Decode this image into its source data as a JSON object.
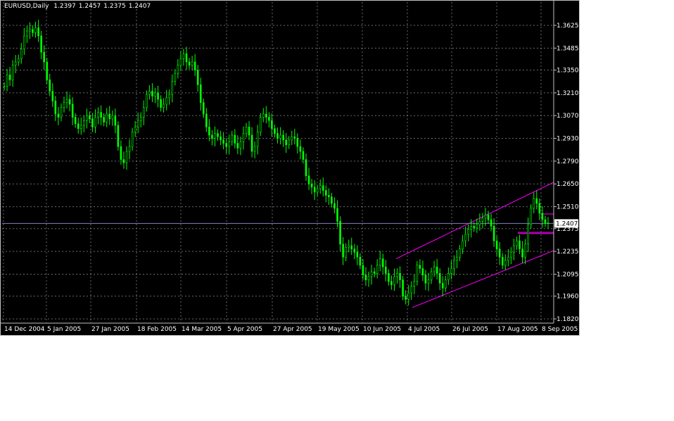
{
  "header": {
    "symbol": "EURUSD,Daily",
    "open": "1.2397",
    "high": "1.2457",
    "low": "1.2375",
    "close": "1.2407"
  },
  "colors": {
    "background": "#000000",
    "candle": "#00ff00",
    "grid": "#c0c0c0",
    "axis_text": "#ffffff",
    "channel": "#ff00ff",
    "bid_line": "#8080c0",
    "price_label_bg": "#ffffff",
    "price_label_text": "#000000"
  },
  "chart_data": {
    "type": "candlestick",
    "title": "EURUSD,Daily",
    "y_ticks": [
      "1.3625",
      "1.3485",
      "1.3350",
      "1.3210",
      "1.3070",
      "1.2930",
      "1.2790",
      "1.2650",
      "1.2510",
      "1.2375",
      "1.2235",
      "1.2095",
      "1.1960",
      "1.1820"
    ],
    "x_ticks": [
      "14 Dec 2004",
      "5 Jan 2005",
      "27 Jan 2005",
      "18 Feb 2005",
      "14 Mar 2005",
      "5 Apr 2005",
      "27 Apr 2005",
      "19 May 2005",
      "10 Jun 2005",
      "4 Jul 2005",
      "26 Jul 2005",
      "17 Aug 2005",
      "8 Sep 2005"
    ],
    "current_price": "1.2407",
    "ylim": [
      1.182,
      1.3625
    ],
    "grid": true,
    "approx_closes": [
      1.325,
      1.332,
      1.329,
      1.338,
      1.34,
      1.342,
      1.348,
      1.356,
      1.359,
      1.36,
      1.358,
      1.361,
      1.356,
      1.346,
      1.34,
      1.329,
      1.322,
      1.316,
      1.308,
      1.306,
      1.312,
      1.315,
      1.317,
      1.314,
      1.306,
      1.302,
      1.299,
      1.301,
      1.304,
      1.307,
      1.305,
      1.3,
      1.306,
      1.309,
      1.306,
      1.303,
      1.308,
      1.305,
      1.307,
      1.301,
      1.288,
      1.28,
      1.278,
      1.285,
      1.288,
      1.297,
      1.3,
      1.304,
      1.306,
      1.312,
      1.32,
      1.322,
      1.319,
      1.321,
      1.317,
      1.312,
      1.314,
      1.318,
      1.32,
      1.328,
      1.333,
      1.338,
      1.342,
      1.345,
      1.34,
      1.338,
      1.34,
      1.335,
      1.326,
      1.315,
      1.308,
      1.3,
      1.295,
      1.293,
      1.296,
      1.294,
      1.292,
      1.29,
      1.288,
      1.291,
      1.295,
      1.29,
      1.287,
      1.291,
      1.296,
      1.3,
      1.295,
      1.285,
      1.288,
      1.297,
      1.306,
      1.308,
      1.306,
      1.304,
      1.299,
      1.296,
      1.293,
      1.295,
      1.292,
      1.289,
      1.292,
      1.294,
      1.293,
      1.288,
      1.285,
      1.28,
      1.27,
      1.265,
      1.263,
      1.26,
      1.262,
      1.264,
      1.261,
      1.258,
      1.257,
      1.253,
      1.25,
      1.242,
      1.228,
      1.22,
      1.226,
      1.227,
      1.225,
      1.223,
      1.22,
      1.215,
      1.209,
      1.206,
      1.208,
      1.211,
      1.21,
      1.215,
      1.219,
      1.214,
      1.21,
      1.205,
      1.203,
      1.208,
      1.21,
      1.206,
      1.196,
      1.194,
      1.198,
      1.202,
      1.205,
      1.215,
      1.213,
      1.209,
      1.204,
      1.206,
      1.211,
      1.214,
      1.21,
      1.204,
      1.201,
      1.206,
      1.21,
      1.213,
      1.218,
      1.22,
      1.225,
      1.23,
      1.234,
      1.237,
      1.239,
      1.238,
      1.24,
      1.242,
      1.244,
      1.246,
      1.243,
      1.239,
      1.23,
      1.225,
      1.22,
      1.215,
      1.218,
      1.22,
      1.223,
      1.227,
      1.23,
      1.225,
      1.22,
      1.228,
      1.24,
      1.25,
      1.256,
      1.253,
      1.247,
      1.243,
      1.241,
      1.2407
    ]
  }
}
